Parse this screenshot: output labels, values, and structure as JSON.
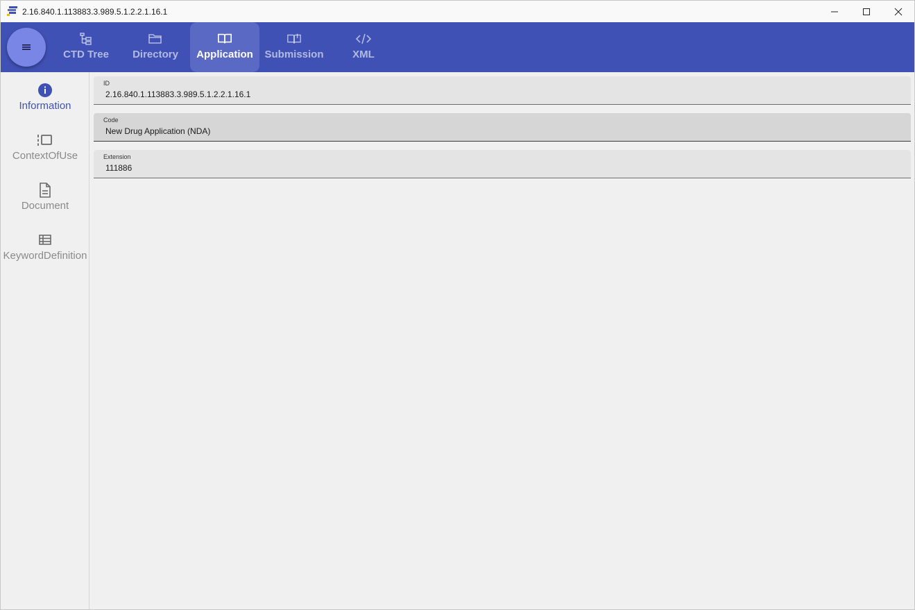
{
  "window": {
    "title": "2.16.840.1.113883.3.989.5.1.2.2.1.16.1"
  },
  "topnav": {
    "menu_icon": "hamburger-icon",
    "tabs": [
      {
        "label": "CTD Tree",
        "icon": "tree-icon",
        "active": false
      },
      {
        "label": "Directory",
        "icon": "folder-icon",
        "active": false
      },
      {
        "label": "Application",
        "icon": "book-open-icon",
        "active": true
      },
      {
        "label": "Submission",
        "icon": "book-icon",
        "active": false
      },
      {
        "label": "XML",
        "icon": "code-icon",
        "active": false
      }
    ]
  },
  "rail": {
    "items": [
      {
        "label": "Information",
        "icon": "info-icon",
        "active": true
      },
      {
        "label": "ContextOfUse",
        "icon": "context-icon",
        "active": false
      },
      {
        "label": "Document",
        "icon": "document-icon",
        "active": false
      },
      {
        "label": "KeywordDefinition",
        "icon": "table-icon",
        "active": false
      }
    ]
  },
  "fields": [
    {
      "label": "ID",
      "value": "2.16.840.1.113883.3.989.5.1.2.2.1.16.1"
    },
    {
      "label": "Code",
      "value": "New Drug Application (NDA)"
    },
    {
      "label": "Extension",
      "value": "111886"
    }
  ],
  "colors": {
    "primary": "#3f51b5",
    "fab": "#7986e6",
    "active_tab": "#5a69c4",
    "background": "#f0f0f0"
  }
}
